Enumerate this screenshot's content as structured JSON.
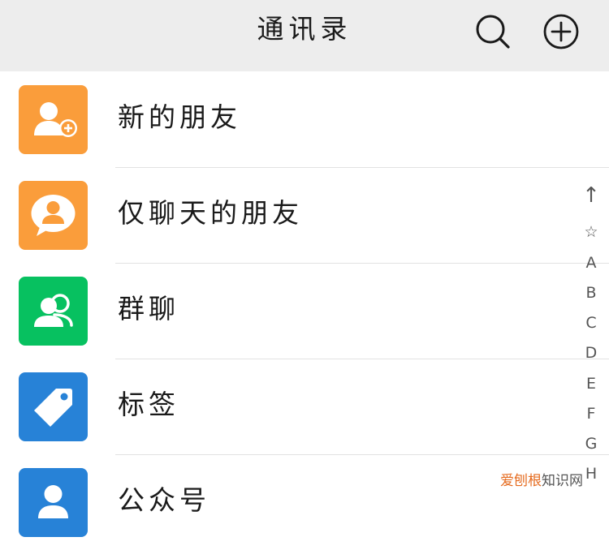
{
  "header": {
    "title": "通讯录",
    "search_icon": "search-icon",
    "add_icon": "plus-circle-icon"
  },
  "colors": {
    "header_bg": "#ededed",
    "orange": "#fa9d3b",
    "green": "#07c160",
    "blue": "#2782d7",
    "divider": "#e2e2e2"
  },
  "rows": [
    {
      "label": "新的朋友",
      "icon": "add-friend-icon",
      "color": "#fa9d3b"
    },
    {
      "label": "仅聊天的朋友",
      "icon": "chat-only-friend-icon",
      "color": "#fa9d3b"
    },
    {
      "label": "群聊",
      "icon": "group-chat-icon",
      "color": "#07c160"
    },
    {
      "label": "标签",
      "icon": "tag-icon",
      "color": "#2782d7"
    },
    {
      "label": "公众号",
      "icon": "official-account-icon",
      "color": "#2782d7"
    }
  ],
  "index_bar": [
    "↑",
    "☆",
    "A",
    "B",
    "C",
    "D",
    "E",
    "F",
    "G",
    "H"
  ],
  "watermark": {
    "part1": "爱刨根",
    "part2": "知识网"
  }
}
